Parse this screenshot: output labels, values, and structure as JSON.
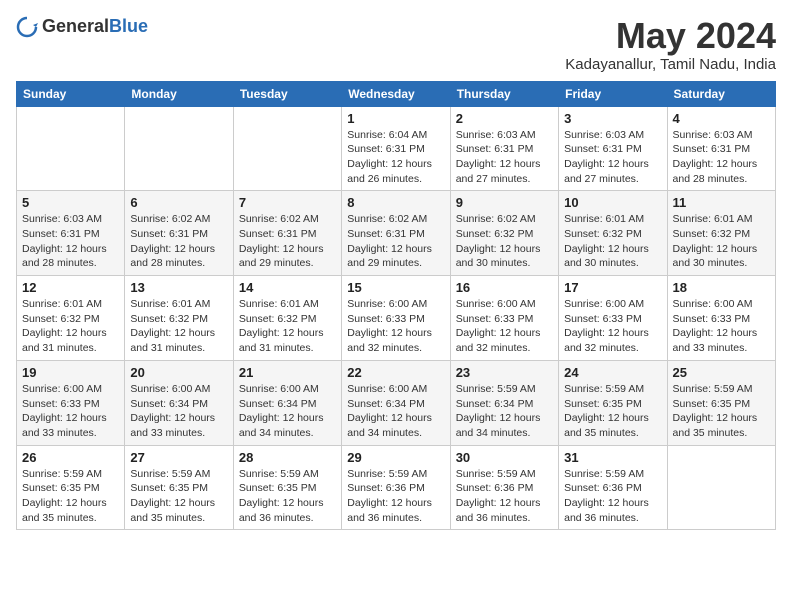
{
  "logo": {
    "general": "General",
    "blue": "Blue"
  },
  "title": {
    "month_year": "May 2024",
    "location": "Kadayanallur, Tamil Nadu, India"
  },
  "weekdays": [
    "Sunday",
    "Monday",
    "Tuesday",
    "Wednesday",
    "Thursday",
    "Friday",
    "Saturday"
  ],
  "weeks": [
    [
      {
        "day": "",
        "info": ""
      },
      {
        "day": "",
        "info": ""
      },
      {
        "day": "",
        "info": ""
      },
      {
        "day": "1",
        "info": "Sunrise: 6:04 AM\nSunset: 6:31 PM\nDaylight: 12 hours\nand 26 minutes."
      },
      {
        "day": "2",
        "info": "Sunrise: 6:03 AM\nSunset: 6:31 PM\nDaylight: 12 hours\nand 27 minutes."
      },
      {
        "day": "3",
        "info": "Sunrise: 6:03 AM\nSunset: 6:31 PM\nDaylight: 12 hours\nand 27 minutes."
      },
      {
        "day": "4",
        "info": "Sunrise: 6:03 AM\nSunset: 6:31 PM\nDaylight: 12 hours\nand 28 minutes."
      }
    ],
    [
      {
        "day": "5",
        "info": "Sunrise: 6:03 AM\nSunset: 6:31 PM\nDaylight: 12 hours\nand 28 minutes."
      },
      {
        "day": "6",
        "info": "Sunrise: 6:02 AM\nSunset: 6:31 PM\nDaylight: 12 hours\nand 28 minutes."
      },
      {
        "day": "7",
        "info": "Sunrise: 6:02 AM\nSunset: 6:31 PM\nDaylight: 12 hours\nand 29 minutes."
      },
      {
        "day": "8",
        "info": "Sunrise: 6:02 AM\nSunset: 6:31 PM\nDaylight: 12 hours\nand 29 minutes."
      },
      {
        "day": "9",
        "info": "Sunrise: 6:02 AM\nSunset: 6:32 PM\nDaylight: 12 hours\nand 30 minutes."
      },
      {
        "day": "10",
        "info": "Sunrise: 6:01 AM\nSunset: 6:32 PM\nDaylight: 12 hours\nand 30 minutes."
      },
      {
        "day": "11",
        "info": "Sunrise: 6:01 AM\nSunset: 6:32 PM\nDaylight: 12 hours\nand 30 minutes."
      }
    ],
    [
      {
        "day": "12",
        "info": "Sunrise: 6:01 AM\nSunset: 6:32 PM\nDaylight: 12 hours\nand 31 minutes."
      },
      {
        "day": "13",
        "info": "Sunrise: 6:01 AM\nSunset: 6:32 PM\nDaylight: 12 hours\nand 31 minutes."
      },
      {
        "day": "14",
        "info": "Sunrise: 6:01 AM\nSunset: 6:32 PM\nDaylight: 12 hours\nand 31 minutes."
      },
      {
        "day": "15",
        "info": "Sunrise: 6:00 AM\nSunset: 6:33 PM\nDaylight: 12 hours\nand 32 minutes."
      },
      {
        "day": "16",
        "info": "Sunrise: 6:00 AM\nSunset: 6:33 PM\nDaylight: 12 hours\nand 32 minutes."
      },
      {
        "day": "17",
        "info": "Sunrise: 6:00 AM\nSunset: 6:33 PM\nDaylight: 12 hours\nand 32 minutes."
      },
      {
        "day": "18",
        "info": "Sunrise: 6:00 AM\nSunset: 6:33 PM\nDaylight: 12 hours\nand 33 minutes."
      }
    ],
    [
      {
        "day": "19",
        "info": "Sunrise: 6:00 AM\nSunset: 6:33 PM\nDaylight: 12 hours\nand 33 minutes."
      },
      {
        "day": "20",
        "info": "Sunrise: 6:00 AM\nSunset: 6:34 PM\nDaylight: 12 hours\nand 33 minutes."
      },
      {
        "day": "21",
        "info": "Sunrise: 6:00 AM\nSunset: 6:34 PM\nDaylight: 12 hours\nand 34 minutes."
      },
      {
        "day": "22",
        "info": "Sunrise: 6:00 AM\nSunset: 6:34 PM\nDaylight: 12 hours\nand 34 minutes."
      },
      {
        "day": "23",
        "info": "Sunrise: 5:59 AM\nSunset: 6:34 PM\nDaylight: 12 hours\nand 34 minutes."
      },
      {
        "day": "24",
        "info": "Sunrise: 5:59 AM\nSunset: 6:35 PM\nDaylight: 12 hours\nand 35 minutes."
      },
      {
        "day": "25",
        "info": "Sunrise: 5:59 AM\nSunset: 6:35 PM\nDaylight: 12 hours\nand 35 minutes."
      }
    ],
    [
      {
        "day": "26",
        "info": "Sunrise: 5:59 AM\nSunset: 6:35 PM\nDaylight: 12 hours\nand 35 minutes."
      },
      {
        "day": "27",
        "info": "Sunrise: 5:59 AM\nSunset: 6:35 PM\nDaylight: 12 hours\nand 35 minutes."
      },
      {
        "day": "28",
        "info": "Sunrise: 5:59 AM\nSunset: 6:35 PM\nDaylight: 12 hours\nand 36 minutes."
      },
      {
        "day": "29",
        "info": "Sunrise: 5:59 AM\nSunset: 6:36 PM\nDaylight: 12 hours\nand 36 minutes."
      },
      {
        "day": "30",
        "info": "Sunrise: 5:59 AM\nSunset: 6:36 PM\nDaylight: 12 hours\nand 36 minutes."
      },
      {
        "day": "31",
        "info": "Sunrise: 5:59 AM\nSunset: 6:36 PM\nDaylight: 12 hours\nand 36 minutes."
      },
      {
        "day": "",
        "info": ""
      }
    ]
  ]
}
